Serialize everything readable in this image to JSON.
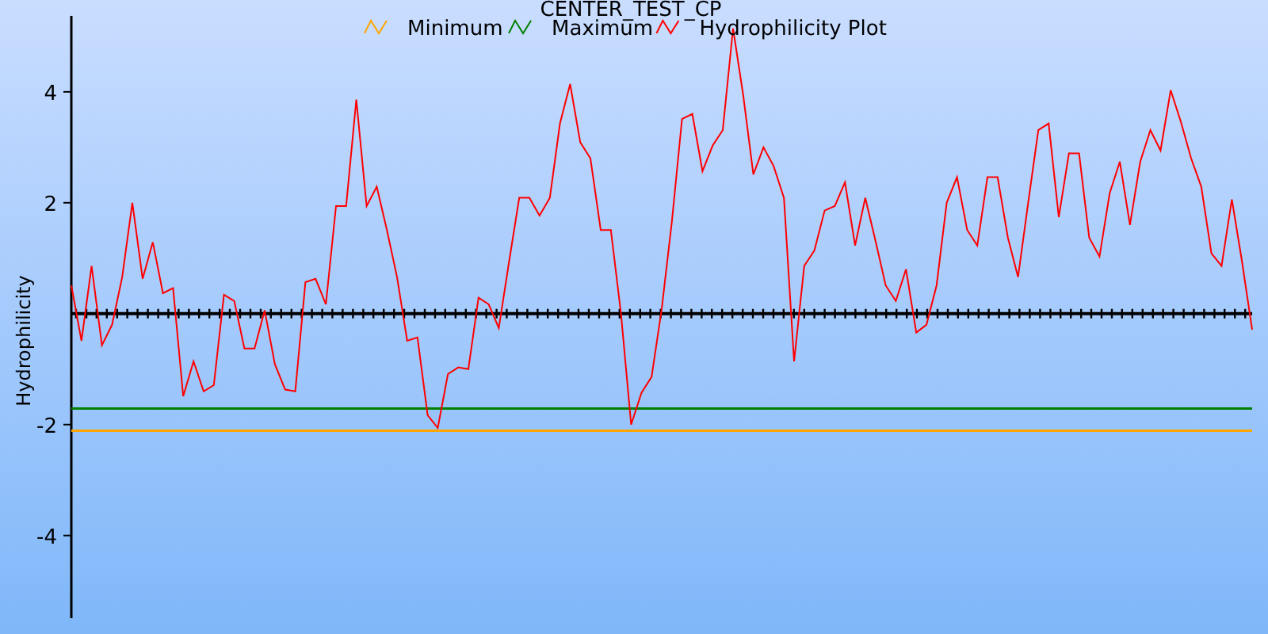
{
  "chart_data": {
    "type": "line",
    "title": "CENTER_TEST_CP",
    "ylabel": "Hydrophilicity",
    "categories": [
      null,
      null,
      null,
      null,
      null,
      null,
      null,
      null,
      null,
      null,
      null,
      null,
      null,
      null,
      null,
      null,
      null,
      null,
      null,
      null,
      null,
      null,
      null,
      null,
      null,
      null,
      null,
      null,
      null,
      null,
      null,
      null,
      null,
      null,
      null,
      null,
      null,
      null,
      null,
      null,
      null,
      null,
      null,
      null,
      null,
      null,
      null,
      null,
      null,
      null,
      null,
      null,
      null,
      null,
      null,
      null,
      null,
      null,
      null,
      null,
      null,
      null,
      null,
      null,
      null,
      null,
      null,
      null,
      null,
      null,
      null,
      null,
      null,
      null,
      null,
      null,
      null,
      null,
      null,
      null,
      null,
      null,
      null,
      null,
      null,
      null,
      null,
      null,
      null,
      null,
      null,
      null,
      null,
      null,
      null,
      null,
      null,
      null,
      null,
      null,
      null,
      null,
      null,
      null,
      null,
      null,
      null,
      null,
      null,
      null,
      null,
      null,
      null,
      null,
      null,
      null,
      null
    ],
    "legend": true,
    "ylim": [
      -5.49,
      5.37
    ],
    "yticks": [
      4,
      2,
      -2,
      -4
    ],
    "series": [
      {
        "name": "Minimum",
        "color": "#ffa500",
        "values": [
          -2.11,
          -2.11,
          -2.11,
          -2.11,
          -2.11,
          -2.11,
          -2.11,
          -2.11,
          -2.11,
          -2.11,
          -2.11,
          -2.11,
          -2.11,
          -2.11,
          -2.11,
          -2.11,
          -2.11,
          -2.11,
          -2.11,
          -2.11,
          -2.11,
          -2.11,
          -2.11,
          -2.11,
          -2.11,
          -2.11,
          -2.11,
          -2.11,
          -2.11,
          -2.11,
          -2.11,
          -2.11,
          -2.11,
          -2.11,
          -2.11,
          -2.11,
          -2.11,
          -2.11,
          -2.11,
          -2.11,
          -2.11,
          -2.11,
          -2.11,
          -2.11,
          -2.11,
          -2.11,
          -2.11,
          -2.11,
          -2.11,
          -2.11,
          -2.11,
          -2.11,
          -2.11,
          -2.11,
          -2.11,
          -2.11,
          -2.11,
          -2.11,
          -2.11,
          -2.11,
          -2.11,
          -2.11,
          -2.11,
          -2.11,
          -2.11,
          -2.11,
          -2.11,
          -2.11,
          -2.11,
          -2.11,
          -2.11,
          -2.11,
          -2.11,
          -2.11,
          -2.11,
          -2.11,
          -2.11,
          -2.11,
          -2.11,
          -2.11,
          -2.11,
          -2.11,
          -2.11,
          -2.11,
          -2.11,
          -2.11,
          -2.11,
          -2.11,
          -2.11,
          -2.11,
          -2.11,
          -2.11,
          -2.11,
          -2.11,
          -2.11,
          -2.11,
          -2.11,
          -2.11,
          -2.11,
          -2.11,
          -2.11,
          -2.11,
          -2.11,
          -2.11,
          -2.11,
          -2.11,
          -2.11,
          -2.11,
          -2.11,
          -2.11,
          -2.11,
          -2.11,
          -2.11,
          -2.11,
          -2.11,
          -2.11,
          -2.11
        ]
      },
      {
        "name": "Maximum",
        "color": "#008000",
        "values": [
          -1.71,
          -1.71,
          -1.71,
          -1.71,
          -1.71,
          -1.71,
          -1.71,
          -1.71,
          -1.71,
          -1.71,
          -1.71,
          -1.71,
          -1.71,
          -1.71,
          -1.71,
          -1.71,
          -1.71,
          -1.71,
          -1.71,
          -1.71,
          -1.71,
          -1.71,
          -1.71,
          -1.71,
          -1.71,
          -1.71,
          -1.71,
          -1.71,
          -1.71,
          -1.71,
          -1.71,
          -1.71,
          -1.71,
          -1.71,
          -1.71,
          -1.71,
          -1.71,
          -1.71,
          -1.71,
          -1.71,
          -1.71,
          -1.71,
          -1.71,
          -1.71,
          -1.71,
          -1.71,
          -1.71,
          -1.71,
          -1.71,
          -1.71,
          -1.71,
          -1.71,
          -1.71,
          -1.71,
          -1.71,
          -1.71,
          -1.71,
          -1.71,
          -1.71,
          -1.71,
          -1.71,
          -1.71,
          -1.71,
          -1.71,
          -1.71,
          -1.71,
          -1.71,
          -1.71,
          -1.71,
          -1.71,
          -1.71,
          -1.71,
          -1.71,
          -1.71,
          -1.71,
          -1.71,
          -1.71,
          -1.71,
          -1.71,
          -1.71,
          -1.71,
          -1.71,
          -1.71,
          -1.71,
          -1.71,
          -1.71,
          -1.71,
          -1.71,
          -1.71,
          -1.71,
          -1.71,
          -1.71,
          -1.71,
          -1.71,
          -1.71,
          -1.71,
          -1.71,
          -1.71,
          -1.71,
          -1.71,
          -1.71,
          -1.71,
          -1.71,
          -1.71,
          -1.71,
          -1.71,
          -1.71,
          -1.71,
          -1.71,
          -1.71,
          -1.71,
          -1.71,
          -1.71,
          -1.71,
          -1.71,
          -1.71,
          -1.71
        ]
      },
      {
        "name": "Hydrophilicity Plot",
        "color": "#ff0000",
        "values": [
          0.51,
          -0.49,
          0.86,
          -0.57,
          -0.2,
          0.66,
          2.0,
          0.63,
          1.29,
          0.37,
          0.46,
          -1.49,
          -0.86,
          -1.4,
          -1.29,
          0.34,
          0.23,
          -0.63,
          -0.63,
          0.06,
          -0.91,
          -1.37,
          -1.4,
          0.57,
          0.63,
          0.17,
          1.94,
          1.94,
          3.86,
          1.94,
          2.29,
          1.51,
          0.66,
          -0.49,
          -0.43,
          -1.83,
          -2.06,
          -1.09,
          -0.97,
          -1.0,
          0.29,
          0.17,
          -0.26,
          0.94,
          2.09,
          2.09,
          1.77,
          2.09,
          3.43,
          4.14,
          3.09,
          2.8,
          1.51,
          1.51,
          0,
          -2.0,
          -1.43,
          -1.14,
          0.09,
          1.66,
          3.51,
          3.6,
          2.57,
          3.03,
          3.31,
          5.14,
          3.94,
          2.51,
          3.0,
          2.66,
          2.09,
          -0.86,
          0.86,
          1.14,
          1.86,
          1.94,
          2.37,
          1.23,
          2.09,
          1.31,
          0.51,
          0.23,
          0.8,
          -0.34,
          -0.2,
          0.51,
          2.0,
          2.46,
          1.51,
          1.23,
          2.46,
          2.46,
          1.37,
          0.66,
          2.0,
          3.31,
          3.43,
          1.74,
          2.89,
          2.89,
          1.37,
          1.03,
          2.17,
          2.74,
          1.6,
          2.74,
          3.31,
          2.94,
          4.03,
          3.46,
          2.8,
          2.29,
          1.09,
          0.86,
          2.06,
          0.94,
          -0.29
        ]
      }
    ]
  }
}
